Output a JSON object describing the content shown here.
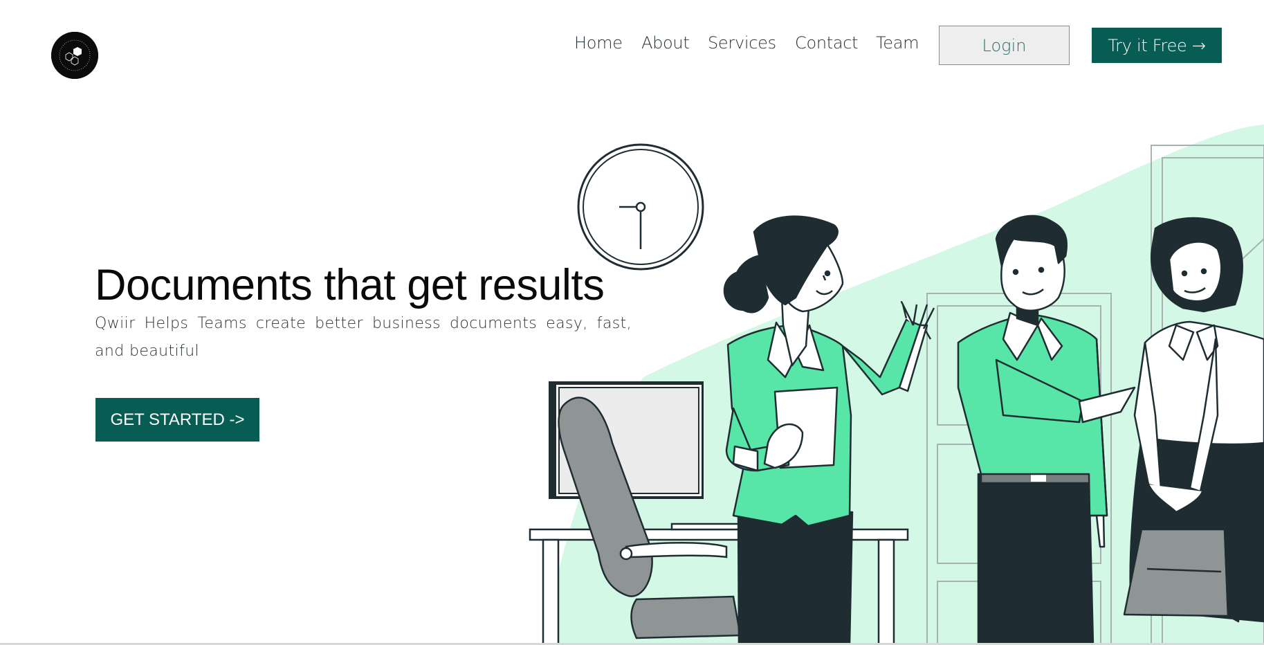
{
  "header": {
    "logo_icon": "brand-logo-icon",
    "nav": [
      {
        "label": "Home"
      },
      {
        "label": "About"
      },
      {
        "label": "Services"
      },
      {
        "label": "Contact"
      },
      {
        "label": "Team"
      }
    ],
    "login_label": "Login",
    "try_label": "Try it Free →"
  },
  "hero": {
    "title": "Documents that get results",
    "subtitle": "Qwiir Helps Teams create better business documents easy, fast, and beautiful",
    "cta_label": "GET STARTED ->"
  },
  "colors": {
    "brand": "#075c53",
    "accent_green": "#58e5a8",
    "mint_background": "#d4f8e6",
    "dark": "#1f2d33"
  },
  "illustration_icons": [
    "wall-clock-icon",
    "desk-monitor-icon",
    "office-chair-icon",
    "briefcase-icon",
    "door-icon"
  ]
}
